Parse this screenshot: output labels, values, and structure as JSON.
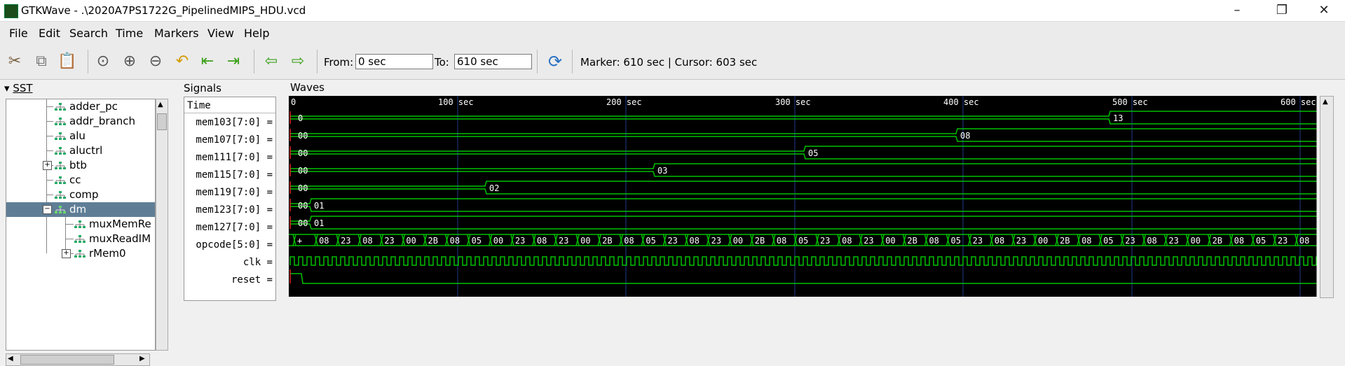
{
  "window": {
    "title": "GTKWave - .\\2020A7PS1722G_PipelinedMIPS_HDU.vcd"
  },
  "menu": [
    "File",
    "Edit",
    "Search",
    "Time",
    "Markers",
    "View",
    "Help"
  ],
  "toolbar": {
    "from_label": "From:",
    "from_value": "0 sec",
    "to_label": "To:",
    "to_value": "610 sec",
    "marker_text": "Marker: 610 sec  |  Cursor: 603 sec"
  },
  "sst": {
    "title": "SST",
    "items": [
      {
        "label": "adder_pc"
      },
      {
        "label": "addr_branch"
      },
      {
        "label": "alu"
      },
      {
        "label": "aluctrl"
      },
      {
        "label": "btb"
      },
      {
        "label": "cc"
      },
      {
        "label": "comp"
      },
      {
        "label": "dm"
      },
      {
        "label": "muxMemRe"
      },
      {
        "label": "muxReadIM"
      },
      {
        "label": "rMem0"
      }
    ]
  },
  "signals": {
    "title": "Signals",
    "time_label": "Time",
    "rows": [
      "mem103[7:0] =",
      "mem107[7:0] =",
      "mem111[7:0] =",
      "mem115[7:0] =",
      "mem119[7:0] =",
      "mem123[7:0] =",
      "mem127[7:0] =",
      "opcode[5:0] =",
      "clk =",
      "reset ="
    ]
  },
  "waves": {
    "title": "Waves",
    "ticks": [
      "0",
      "100 sec",
      "200 sec",
      "300 sec",
      "400 sec",
      "500 sec",
      "600 sec"
    ],
    "mem103": {
      "v0": "0",
      "v1": "13"
    },
    "mem107": {
      "v0": "00",
      "v1": "08"
    },
    "mem111": {
      "v0": "00",
      "v1": "05"
    },
    "mem115": {
      "v0": "00",
      "v1": "03"
    },
    "mem119": {
      "v0": "00",
      "v1": "02"
    },
    "mem123": {
      "v0": "00",
      "v1": "01"
    },
    "mem127": {
      "v0": "00",
      "v1": "01"
    },
    "opcode": [
      "+",
      "08",
      "23",
      "08",
      "23",
      "00",
      "2B",
      "08",
      "05",
      "00",
      "23",
      "08",
      "23",
      "00",
      "2B",
      "08",
      "05",
      "23",
      "08",
      "23",
      "00",
      "2B",
      "08",
      "05",
      "23",
      "08",
      "23",
      "00",
      "2B",
      "08",
      "05",
      "23",
      "08",
      "23",
      "00",
      "2B",
      "08",
      "05",
      "23",
      "08",
      "23",
      "00",
      "2B",
      "08",
      "05",
      "23",
      "08"
    ]
  },
  "colors": {
    "wave": "#00c000",
    "selection": "#5f7e96",
    "grid": "#1f3b8a"
  }
}
